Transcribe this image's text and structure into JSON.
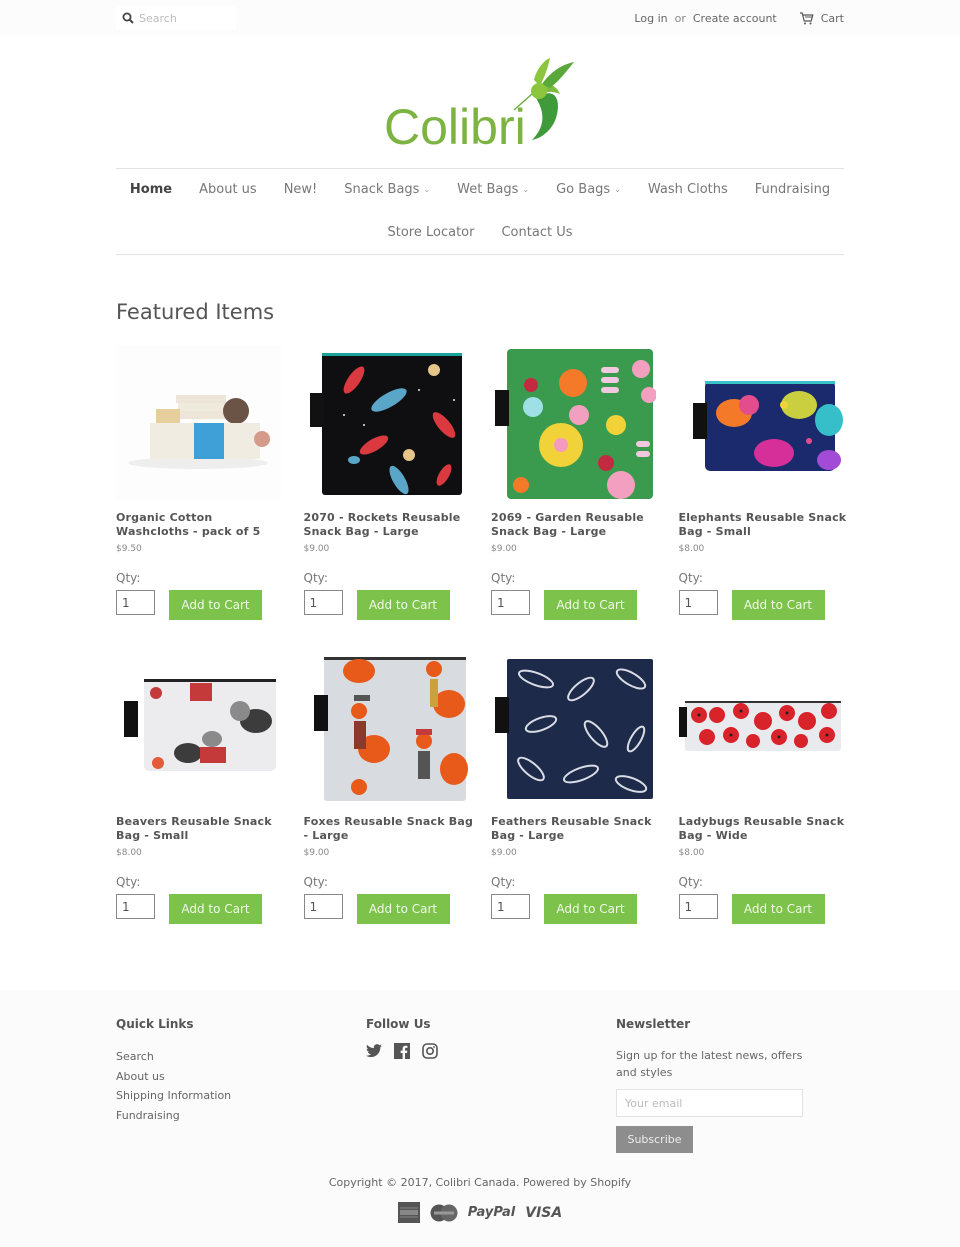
{
  "header": {
    "search_placeholder": "Search",
    "login": "Log in",
    "or": "or",
    "create_account": "Create account",
    "cart": "Cart"
  },
  "brand": {
    "name": "Colibri",
    "color": "#7cb342"
  },
  "nav": {
    "row1": [
      {
        "label": "Home",
        "active": true,
        "dropdown": false
      },
      {
        "label": "About us",
        "dropdown": false
      },
      {
        "label": "New!",
        "dropdown": false
      },
      {
        "label": "Snack Bags",
        "dropdown": true
      },
      {
        "label": "Wet Bags",
        "dropdown": true
      },
      {
        "label": "Go Bags",
        "dropdown": true
      },
      {
        "label": "Wash Cloths",
        "dropdown": false
      },
      {
        "label": "Fundraising",
        "dropdown": false
      }
    ],
    "row2": [
      {
        "label": "Store Locator",
        "dropdown": false
      },
      {
        "label": "Contact Us",
        "dropdown": false
      }
    ],
    "dropdown_glyph": "⌄"
  },
  "featured": {
    "title": "Featured Items",
    "qty_label": "Qty:",
    "add_to_cart": "Add to Cart",
    "button_color": "#7cc24b",
    "products": [
      {
        "name": "Organic Cotton Washcloths - pack of 5",
        "price": "$9.50",
        "qty": "1",
        "image": "washcloths"
      },
      {
        "name": "2070 - Rockets Reusable Snack Bag - Large",
        "price": "$9.00",
        "qty": "1",
        "image": "rockets"
      },
      {
        "name": "2069 - Garden Reusable Snack Bag - Large",
        "price": "$9.00",
        "qty": "1",
        "image": "garden"
      },
      {
        "name": "Elephants Reusable Snack Bag - Small",
        "price": "$8.00",
        "qty": "1",
        "image": "elephants"
      },
      {
        "name": "Beavers Reusable Snack Bag - Small",
        "price": "$8.00",
        "qty": "1",
        "image": "beavers"
      },
      {
        "name": "Foxes Reusable Snack Bag - Large",
        "price": "$9.00",
        "qty": "1",
        "image": "foxes"
      },
      {
        "name": "Feathers Reusable Snack Bag - Large",
        "price": "$9.00",
        "qty": "1",
        "image": "feathers"
      },
      {
        "name": "Ladybugs Reusable Snack Bag - Wide",
        "price": "$8.00",
        "qty": "1",
        "image": "ladybugs"
      }
    ]
  },
  "footer": {
    "quick_links": {
      "title": "Quick Links",
      "items": [
        "Search",
        "About us",
        "Shipping Information",
        "Fundraising"
      ]
    },
    "follow_us": {
      "title": "Follow Us",
      "icons": [
        "twitter-icon",
        "facebook-icon",
        "instagram-icon"
      ]
    },
    "newsletter": {
      "title": "Newsletter",
      "text": "Sign up for the latest news, offers and styles",
      "email_placeholder": "Your email",
      "subscribe": "Subscribe"
    },
    "copyright": "Copyright © 2017, Colibri Canada.",
    "powered_by": "Powered by Shopify",
    "payments": [
      "American Express",
      "MasterCard",
      "PayPal",
      "VISA"
    ],
    "paypal_label": "PayPal",
    "visa_label": "VISA"
  }
}
